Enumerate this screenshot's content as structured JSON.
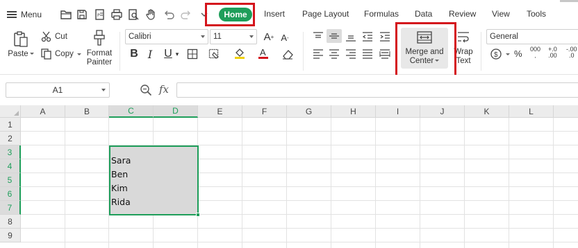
{
  "menubar": {
    "menu_label": "Menu",
    "tabs": {
      "home": "Home",
      "insert": "Insert",
      "page_layout": "Page Layout",
      "formulas": "Formulas",
      "data": "Data",
      "review": "Review",
      "view": "View",
      "tools": "Tools"
    },
    "quick_access_icons": [
      "folder-open-icon",
      "save-icon",
      "export-pdf-icon",
      "print-icon",
      "print-preview-icon",
      "hand-icon",
      "undo-icon",
      "redo-icon",
      "customize-dropdown-icon"
    ]
  },
  "ribbon": {
    "paste": "Paste",
    "cut": "Cut",
    "copy": "Copy",
    "format_painter_line1": "Format",
    "format_painter_line2": "Painter",
    "font_name": "Calibri",
    "font_size": "11",
    "merge_line1": "Merge and",
    "merge_line2": "Center",
    "wrap_line1": "Wrap",
    "wrap_line2": "Text",
    "number_format": "General",
    "percent": "%",
    "thousands": "000",
    "inc_decimal_top": "+.0",
    "inc_decimal_bottom": ".00",
    "dec_decimal_top": "-.00",
    "dec_decimal_bottom": ".0"
  },
  "formula_bar": {
    "name_box": "A1",
    "fx": "fx",
    "content": ""
  },
  "sheet": {
    "columns": [
      "A",
      "B",
      "C",
      "D",
      "E",
      "F",
      "G",
      "H",
      "I",
      "J",
      "K",
      "L"
    ],
    "selected_columns": [
      "C",
      "D"
    ],
    "rows": [
      "1",
      "2",
      "3",
      "4",
      "5",
      "6",
      "7",
      "8",
      "9"
    ],
    "selected_rows": [
      "3",
      "4",
      "5",
      "6",
      "7"
    ],
    "cells": {
      "C4": "Sara",
      "C5": "Ben",
      "C6": "Kim",
      "C7": "Rida"
    }
  },
  "colors": {
    "accent_green": "#1e9e5a",
    "highlight_red": "#d4141c",
    "selection_fill": "#d9d9d9"
  }
}
